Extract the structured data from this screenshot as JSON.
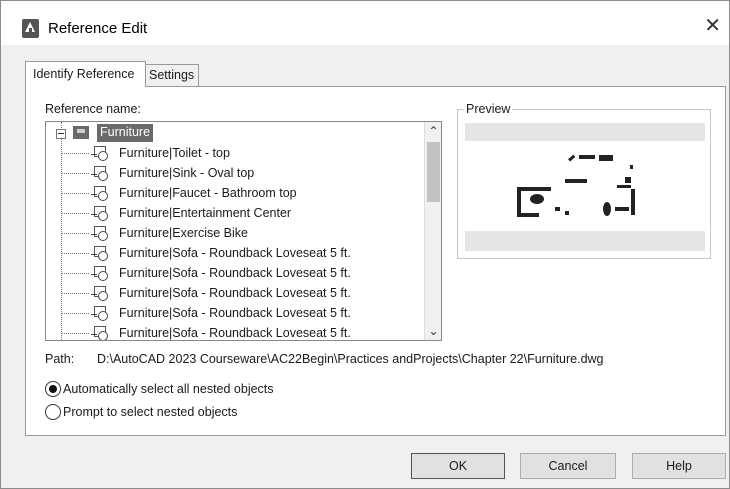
{
  "window": {
    "title": "Reference Edit"
  },
  "tabs": [
    {
      "label": "Identify Reference",
      "active": true
    },
    {
      "label": "Settings",
      "active": false
    }
  ],
  "reference": {
    "label": "Reference name:",
    "root": "Furniture",
    "items": [
      "Furniture|Toilet - top",
      "Furniture|Sink - Oval top",
      "Furniture|Faucet - Bathroom top",
      "Furniture|Entertainment Center",
      "Furniture|Exercise Bike",
      "Furniture|Sofa - Roundback Loveseat 5 ft.",
      "Furniture|Sofa - Roundback Loveseat 5 ft.",
      "Furniture|Sofa - Roundback Loveseat 5 ft.",
      "Furniture|Sofa - Roundback Loveseat 5 ft.",
      "Furniture|Sofa - Roundback Loveseat 5 ft."
    ]
  },
  "preview": {
    "label": "Preview"
  },
  "path": {
    "label": "Path:",
    "value": "D:\\AutoCAD 2023 Courseware\\AC22Begin\\Practices andProjects\\Chapter 22\\Furniture.dwg"
  },
  "options": {
    "auto": {
      "label": "Automatically select all nested objects",
      "checked": true
    },
    "prompt": {
      "label": "Prompt to select nested objects",
      "checked": false
    }
  },
  "buttons": {
    "ok": "OK",
    "cancel": "Cancel",
    "help": "Help"
  },
  "icons": {
    "app": "autocad-app-icon",
    "close": "close-icon",
    "tree_root": "block-reference-icon",
    "tree_item": "xref-block-icon"
  },
  "colors": {
    "selection": "#6a6a6a",
    "preview_bg": "#e6e6e6"
  }
}
